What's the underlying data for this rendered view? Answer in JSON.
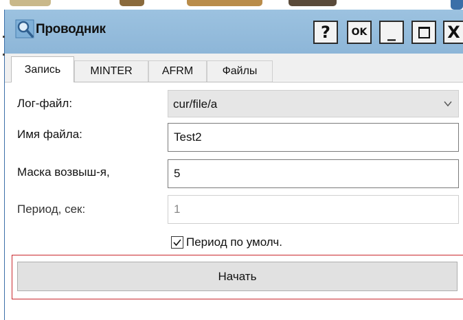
{
  "window": {
    "title": "Проводник",
    "buttons": {
      "help": "?",
      "ok": "OK",
      "minimize": "_",
      "close": "X"
    }
  },
  "tabs": [
    {
      "label": "Запись",
      "active": true
    },
    {
      "label": "MINTER",
      "active": false
    },
    {
      "label": "AFRM",
      "active": false
    },
    {
      "label": "Файлы",
      "active": false
    }
  ],
  "form": {
    "log_file": {
      "label": "Лог-файл:",
      "value": "cur/file/a"
    },
    "file_name": {
      "label": "Имя файла:",
      "value": "Test2"
    },
    "mask": {
      "label": "Маска возвыш-я,",
      "value": "5"
    },
    "period": {
      "label": "Период, сек:",
      "value": "1",
      "enabled": false
    },
    "default_period": {
      "label": "Период по умолч.",
      "checked": true
    }
  },
  "actions": {
    "start": "Начать"
  },
  "colors": {
    "titlebar": "#9cc2e0",
    "focus_frame": "#c9262c",
    "window_border": "#3b6fa8"
  }
}
